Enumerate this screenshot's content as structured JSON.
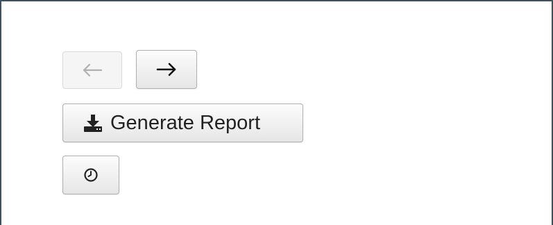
{
  "toolbar": {
    "back_button": {
      "icon": "arrow-left-icon",
      "disabled": true
    },
    "forward_button": {
      "icon": "arrow-right-icon",
      "disabled": false
    },
    "report_button": {
      "label": "Generate Report",
      "icon": "download-icon"
    },
    "history_button": {
      "icon": "clock-icon"
    }
  },
  "colors": {
    "frame_border": "#3f5060",
    "button_border": "#adadad",
    "disabled_icon": "#b0b0b0",
    "icon": "#222222"
  }
}
